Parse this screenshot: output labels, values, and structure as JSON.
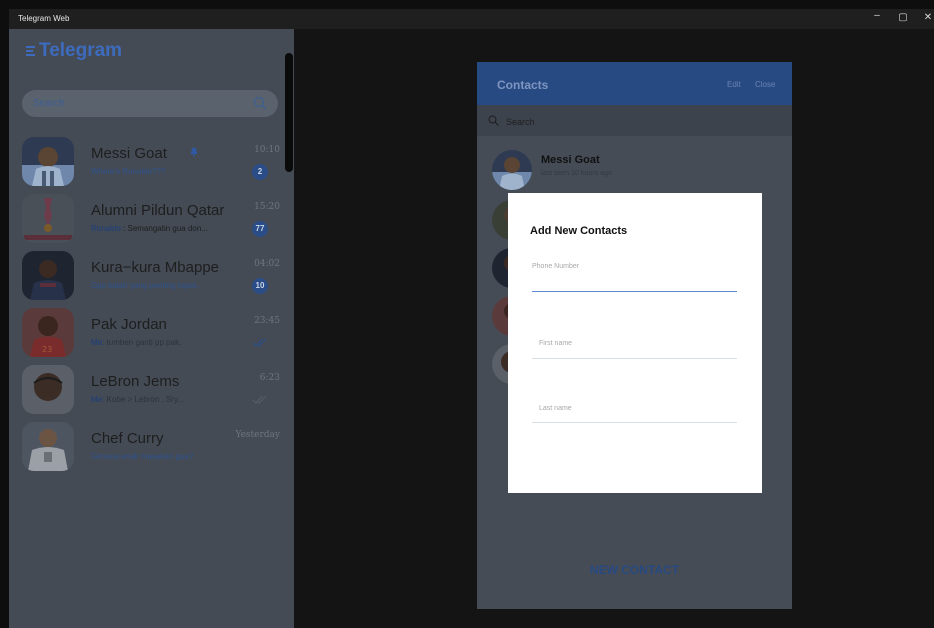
{
  "window": {
    "title": "Telegram Web",
    "controls": [
      "–",
      "▢",
      "✕"
    ]
  },
  "sidebar": {
    "logo": "Telegram",
    "search_placeholder": "Search",
    "chats": [
      {
        "name": "Messi Goat",
        "preview_prefix": "",
        "preview": "Where's Ronaldo???",
        "time": "10:10",
        "badge": "2",
        "muted_icon": "bell-icon"
      },
      {
        "name": "Alumni Pildun Qatar",
        "preview_prefix": "Ronaldo",
        "preview": " : Semangatin gua don...",
        "time": "15:20",
        "badge": "77"
      },
      {
        "name": "Kura−kura Mbappe",
        "preview_prefix": "",
        "preview": "Gpp kalah yang penting topsk..",
        "time": "04:02",
        "badge": "10"
      },
      {
        "name": "Pak Jordan",
        "preview_prefix": "Me:",
        "preview": " tumben ganti pp pak.",
        "time": "23:45",
        "status": "read"
      },
      {
        "name": "LeBron Jems",
        "preview_prefix": "Me:",
        "preview": " Kobe > Lebron , Sry...",
        "time": "6:23",
        "status": "read"
      },
      {
        "name": "Chef Curry",
        "preview_prefix": "",
        "preview": "Gimana enak masakan gua?",
        "time": "Yesterday"
      }
    ]
  },
  "contacts_panel": {
    "title": "Contacts",
    "edit_label": "Edit",
    "close_label": "Close",
    "search_placeholder": "Search",
    "first_contact": {
      "name": "Messi Goat",
      "status": "last seen 10 hours ago"
    },
    "new_contact_label": "NEW CONTACT"
  },
  "modal": {
    "title": "Add New Contacts",
    "phone_placeholder": "Phone Number",
    "first_name_placeholder": "First name",
    "last_name_placeholder": "Last name"
  },
  "colors": {
    "accent": "#3d6bbd",
    "header": "#284a83",
    "overlay_panel": "#444b55"
  }
}
